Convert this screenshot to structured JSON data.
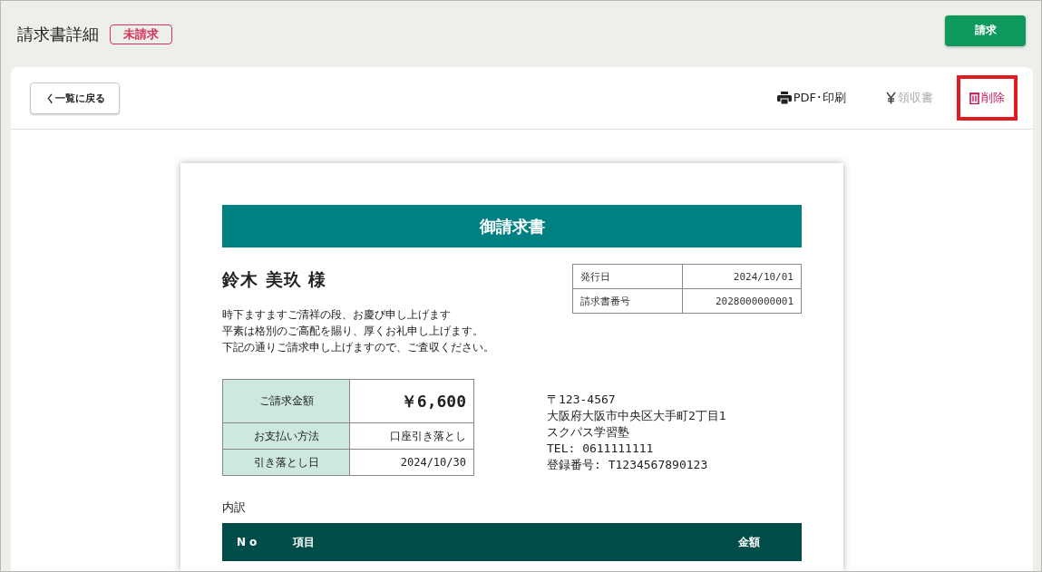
{
  "header": {
    "title": "請求書詳細",
    "status_badge": "未請求",
    "primary_button": "請求"
  },
  "toolbar": {
    "back_button": "く一覧に戻る",
    "actions": [
      {
        "kind": "print",
        "label": "PDF･印刷",
        "disabled": false,
        "highlighted": false
      },
      {
        "kind": "receipt",
        "label": "領収書",
        "disabled": true,
        "highlighted": false
      },
      {
        "kind": "delete",
        "label": "削除",
        "disabled": false,
        "highlighted": true
      }
    ]
  },
  "document": {
    "title": "御請求書",
    "recipient": "鈴木 美玖 様",
    "greeting": [
      "時下ますますご清祥の段、お慶び申し上げます",
      "平素は格別のご高配を賜り、厚くお礼申し上げます。",
      "下記の通りご請求申し上げますので、ご査収ください。"
    ],
    "meta": [
      {
        "label": "発行日",
        "value": "2024/10/01"
      },
      {
        "label": "請求書番号",
        "value": "2028000000001"
      }
    ],
    "summary": [
      {
        "kind": "total",
        "label": "ご請求金額",
        "value": "￥6,600"
      },
      {
        "kind": "normal",
        "label": "お支払い方法",
        "value": "口座引き落とし"
      },
      {
        "kind": "normal",
        "label": "引き落とし日",
        "value": "2024/10/30"
      }
    ],
    "issuer": [
      "〒123-4567",
      "大阪府大阪市中央区大手町2丁目1",
      "スクパス学習塾",
      "TEL: 0611111111",
      "登録番号: T1234567890123"
    ],
    "breakdown_label": "内訳",
    "breakdown_columns": [
      "No",
      "項目",
      "金額"
    ]
  }
}
